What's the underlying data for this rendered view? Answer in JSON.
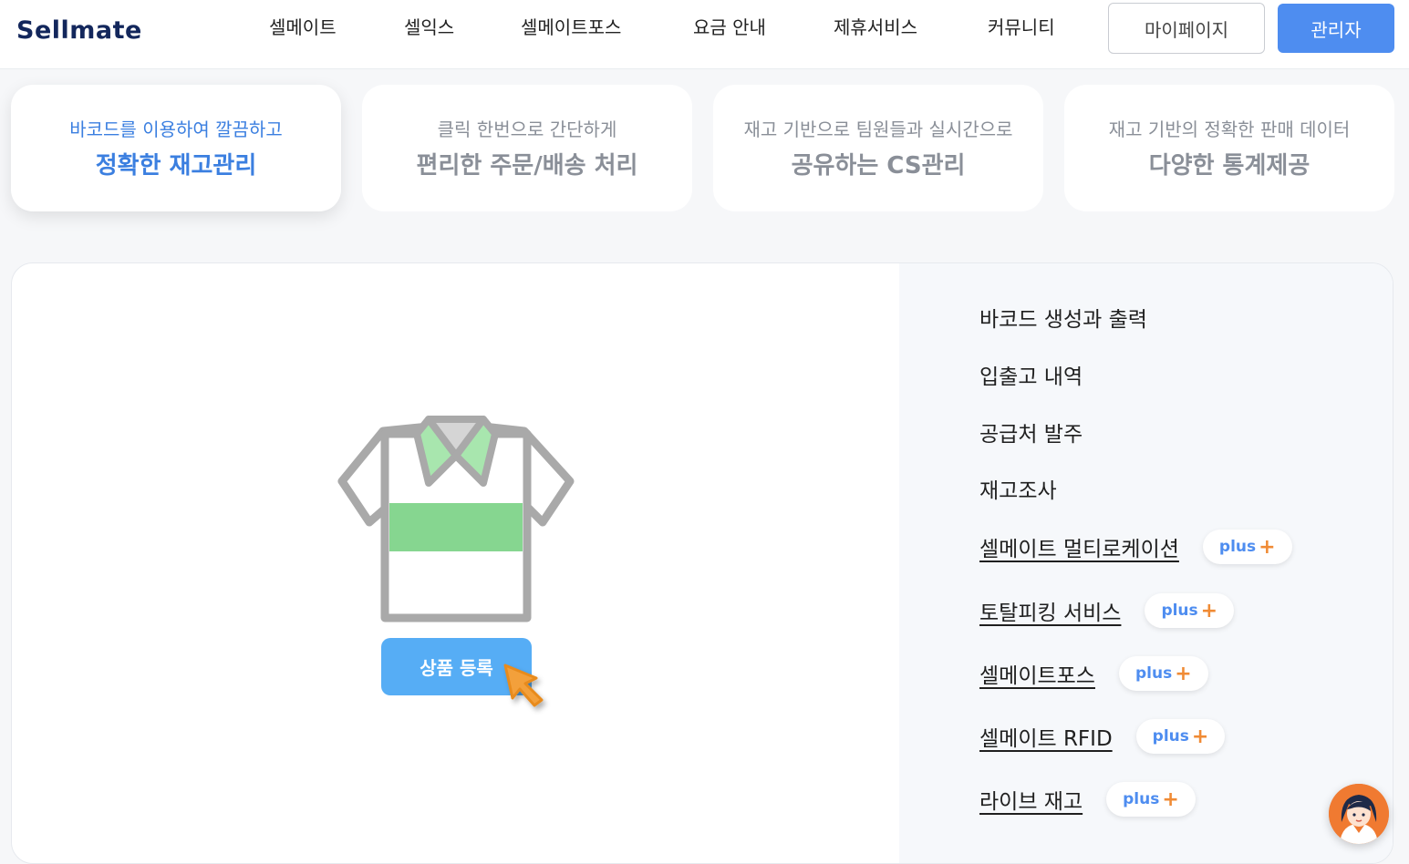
{
  "header": {
    "logo": "Sellmate",
    "nav": [
      "셀메이트",
      "셀익스",
      "셀메이트포스",
      "요금 안내",
      "제휴서비스",
      "커뮤니티"
    ],
    "mypage_label": "마이페이지",
    "admin_label": "관리자"
  },
  "tabs": [
    {
      "sub": "바코드를 이용하여 깔끔하고",
      "main": "정확한 재고관리",
      "active": true
    },
    {
      "sub": "클릭 한번으로 간단하게",
      "main": "편리한 주문/배송 처리",
      "active": false
    },
    {
      "sub": "재고 기반으로 팀원들과 실시간으로",
      "main": "공유하는 CS관리",
      "active": false
    },
    {
      "sub": "재고 기반의 정확한 판매 데이터",
      "main": "다양한 통계제공",
      "active": false
    }
  ],
  "illustration": {
    "button_label": "상품 등록",
    "icons": [
      "polo-shirt-icon",
      "cursor-arrow-icon"
    ]
  },
  "features": [
    {
      "label": "바코드 생성과 출력",
      "link": false
    },
    {
      "label": "입출고 내역",
      "link": false
    },
    {
      "label": "공급처 발주",
      "link": false
    },
    {
      "label": "재고조사",
      "link": false
    },
    {
      "label": "셀메이트 멀티로케이션",
      "link": true,
      "badge": "plus"
    },
    {
      "label": "토탈피킹 서비스",
      "link": true,
      "badge": "plus"
    },
    {
      "label": "셀메이트포스",
      "link": true,
      "badge": "plus"
    },
    {
      "label": "셀메이트 RFID",
      "link": true,
      "badge": "plus"
    },
    {
      "label": "라이브 재고",
      "link": true,
      "badge": "plus"
    }
  ],
  "badge_plus_sign": "+",
  "chat": {
    "icon": "chat-avatar-icon"
  },
  "colors": {
    "brand_navy": "#13275c",
    "accent_blue": "#4e8df0",
    "plus_orange": "#f08b35",
    "shirt_green": "#86d690",
    "button_blue": "#56adf5"
  }
}
